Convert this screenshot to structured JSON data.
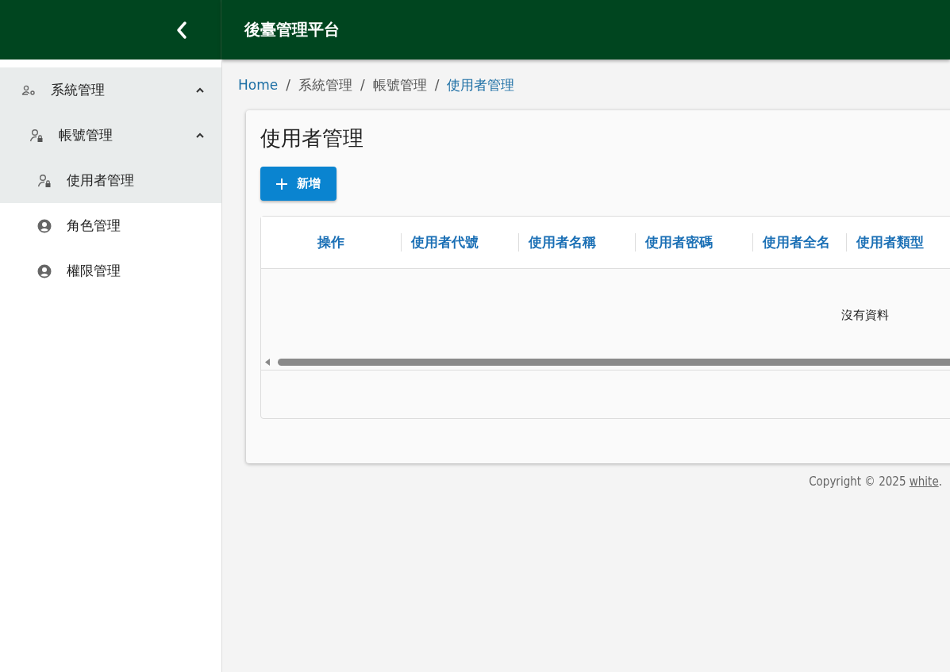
{
  "header": {
    "title": "後臺管理平台"
  },
  "sidebar": {
    "items": [
      {
        "label": "系統管理",
        "kind": "group",
        "active": true,
        "expanded": true,
        "children": [
          {
            "label": "帳號管理",
            "kind": "account",
            "active": true,
            "expanded": true,
            "children": [
              {
                "label": "使用者管理",
                "kind": "account",
                "active": true,
                "selected": true
              },
              {
                "label": "角色管理",
                "kind": "page",
                "active": false,
                "selected": false
              },
              {
                "label": "權限管理",
                "kind": "page",
                "active": false,
                "selected": false
              }
            ]
          }
        ]
      }
    ]
  },
  "breadcrumb": [
    {
      "label": "Home",
      "link": true
    },
    {
      "separator": "/",
      "label": "系統管理",
      "link": false
    },
    {
      "separator": "/",
      "label": "帳號管理",
      "link": false
    },
    {
      "separator": "/",
      "label": "使用者管理",
      "link": true
    }
  ],
  "page_title": "使用者管理",
  "add_button": "新增",
  "table": {
    "columns": [
      "操作",
      "使用者代號",
      "使用者名稱",
      "使用者密碼",
      "使用者全名",
      "使用者類型"
    ],
    "empty_text": "沒有資料"
  },
  "footer": {
    "text": "Copyright © 2025",
    "link": "white",
    "end": "."
  }
}
